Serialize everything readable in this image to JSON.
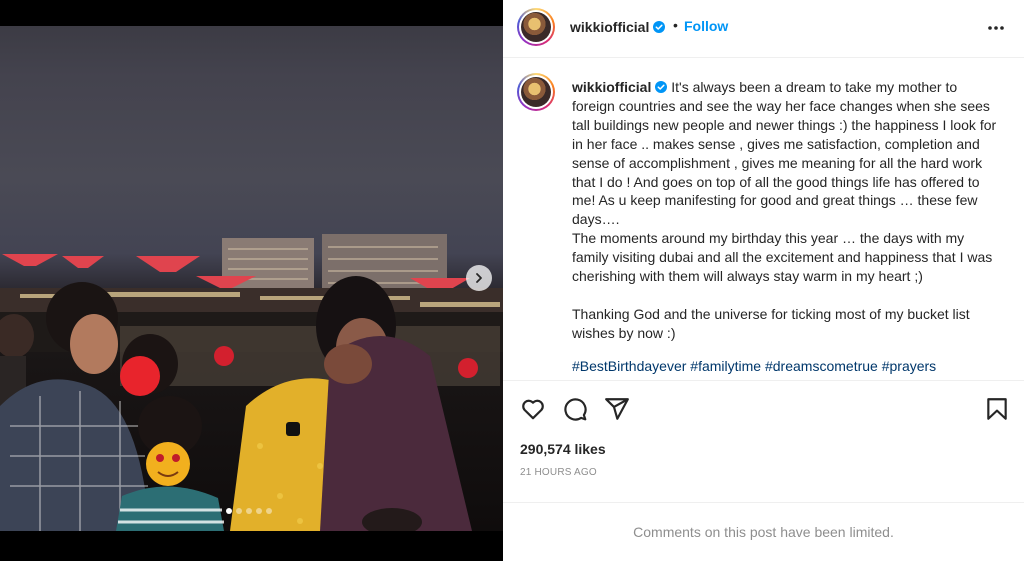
{
  "post": {
    "username": "wikkiofficial",
    "follow_label": "Follow",
    "separator": "•",
    "caption_lines": [
      "It's always been a dream to take my mother to foreign countries and see the way her face changes when she sees tall buildings new people and newer things :) the happiness I look for in her face .. makes sense , gives me satisfaction, completion and sense of accomplishment , gives me meaning for all the hard work that I do ! And goes on top of all the good things life has offered to me! As u keep manifesting for good and great things … these few days….",
      "The moments around my birthday this year … the days with my family visiting dubai and all the excitement and happiness that I was cherishing with them will always stay warm in my heart ;)",
      "",
      "Thanking God and the universe for ticking most of my bucket list wishes by now :)"
    ],
    "hashtags": [
      "#BestBirthdayever",
      "#familytime",
      "#dreamscometrue",
      "#prayers"
    ],
    "likes": "290,574 likes",
    "time": "21 HOURS AGO",
    "comments_notice": "Comments on this post have been limited.",
    "carousel": {
      "dot_count": 5,
      "active_index": 0
    }
  },
  "icons": {
    "verified": "verified-badge-icon",
    "more": "more-options-icon",
    "like": "heart-icon",
    "comment": "comment-icon",
    "share": "share-icon",
    "save": "bookmark-icon",
    "next": "chevron-right-icon"
  },
  "colors": {
    "link": "#0095f6",
    "hashtag": "#00376b",
    "muted": "#8e8e8e",
    "text": "#262626"
  }
}
